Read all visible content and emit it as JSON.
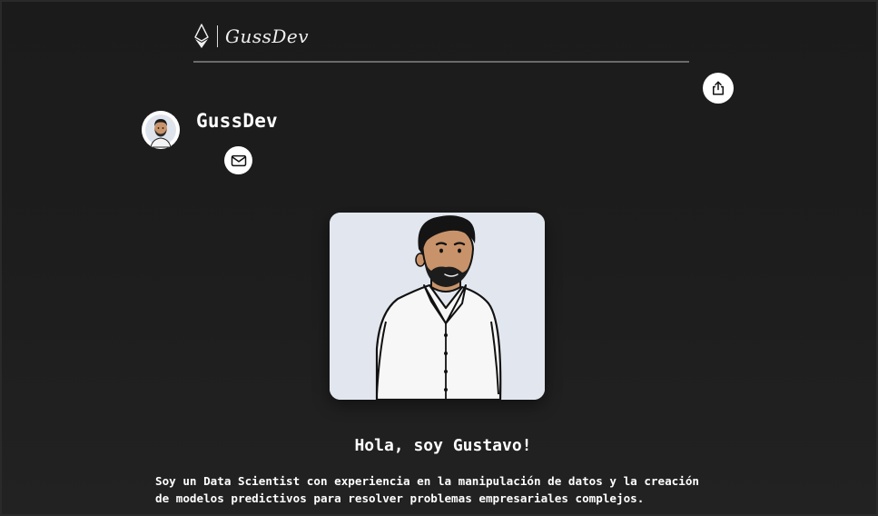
{
  "header": {
    "logo_icon": "ethereum-diamond-icon",
    "logo_text": "GussDev"
  },
  "share": {
    "icon": "share-icon"
  },
  "profile": {
    "name": "GussDev",
    "avatar_icon": "avatar-cartoon",
    "contact_icon": "mail-icon"
  },
  "hero": {
    "image": "cartoon-man-white-shirt-beard"
  },
  "intro": {
    "greeting": "Hola, soy Gustavo!",
    "bio_line1": "Soy un Data Scientist con experiencia en la manipulación de datos y la creación",
    "bio_line2": "de modelos predictivos para resolver problemas empresariales complejos."
  },
  "colors": {
    "background": "#1c1c1c",
    "divider": "#6a6a6a",
    "card_background": "#e2e7ef",
    "text": "#ffffff"
  }
}
